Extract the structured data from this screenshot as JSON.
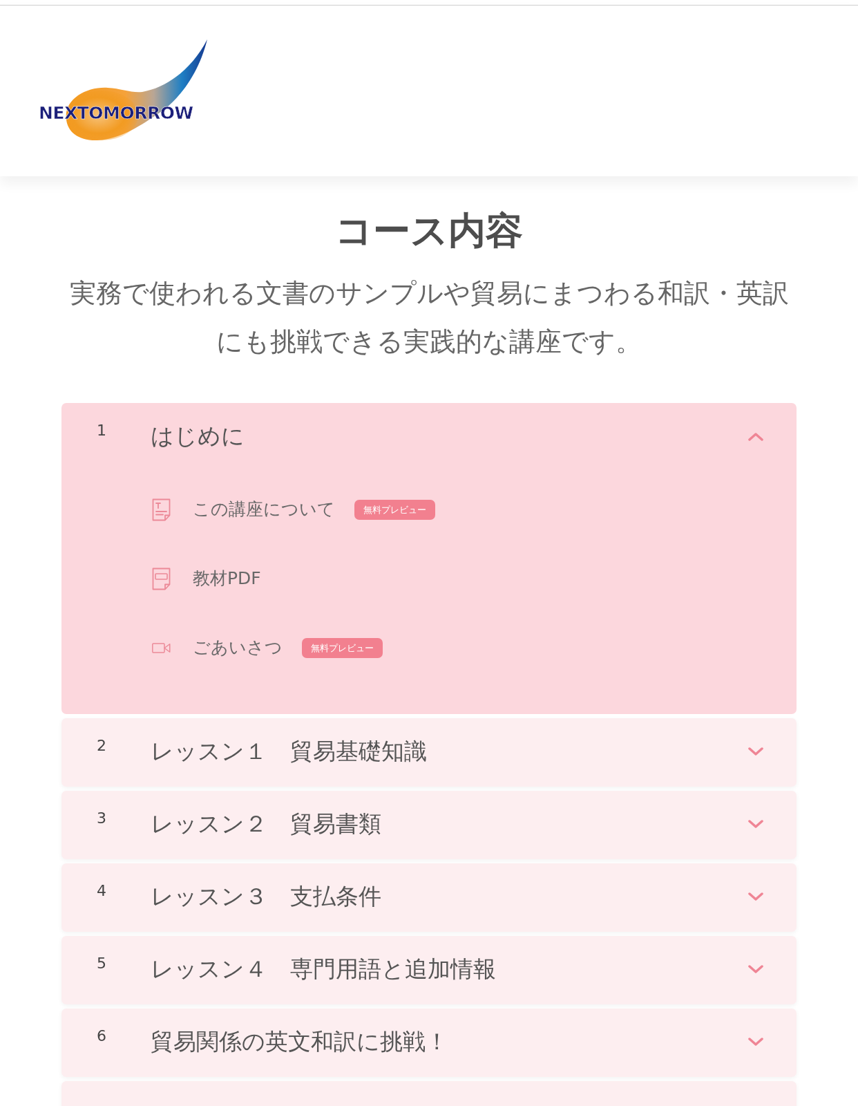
{
  "header": {
    "logo": {
      "wordmark": "NEXTOMORROW"
    }
  },
  "intro": {
    "title": "コース内容",
    "description": "実務で使われる文書のサンプルや貿易にまつわる和訳・英訳にも挑戦できる実践的な講座です。"
  },
  "curriculum": [
    {
      "number": "1",
      "title": "はじめに",
      "expanded": true,
      "lessons": [
        {
          "kind": "text",
          "title": "この講座について",
          "badge": "無料プレビュー"
        },
        {
          "kind": "pdf",
          "title": "教材PDF"
        },
        {
          "kind": "video",
          "title": "ごあいさつ",
          "badge": "無料プレビュー"
        }
      ]
    },
    {
      "number": "2",
      "title": "レッスン１　貿易基礎知識",
      "expanded": false
    },
    {
      "number": "3",
      "title": "レッスン２　貿易書類",
      "expanded": false
    },
    {
      "number": "4",
      "title": "レッスン３　支払条件",
      "expanded": false
    },
    {
      "number": "5",
      "title": "レッスン４　専門用語と追加情報",
      "expanded": false
    },
    {
      "number": "6",
      "title": "貿易関係の英文和訳に挑戦！",
      "expanded": false
    },
    {
      "expanded": false
    }
  ]
}
